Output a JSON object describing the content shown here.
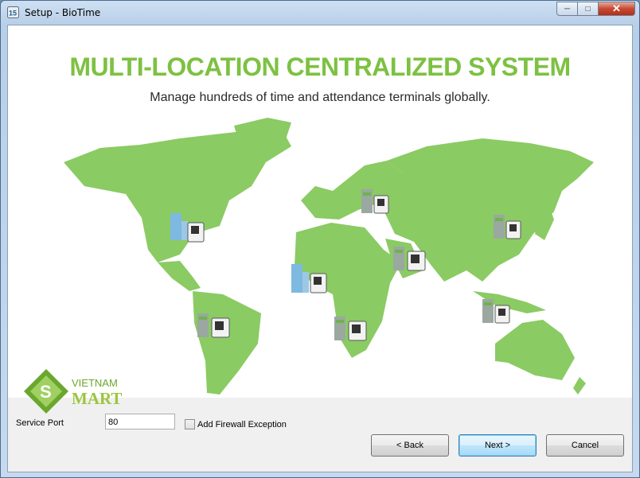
{
  "window": {
    "title": "Setup - BioTime",
    "app_icon": "biotime-app-icon",
    "controls": [
      "minimize-icon",
      "maximize-icon",
      "close-icon"
    ]
  },
  "banner": {
    "headline": "MULTI-LOCATION CENTRALIZED SYSTEM",
    "subheadline": "Manage hundreds of time and attendance terminals globally.",
    "accent_color": "#7dc142",
    "map_color": "#8acb63"
  },
  "watermark": {
    "line1": "VIETNAM",
    "line2": "MART"
  },
  "form": {
    "service_port_label": "Service Port",
    "service_port_value": "80",
    "firewall_label": "Add Firewall Exception",
    "firewall_checked": false
  },
  "buttons": {
    "back": "< Back",
    "next": "Next >",
    "cancel": "Cancel"
  }
}
